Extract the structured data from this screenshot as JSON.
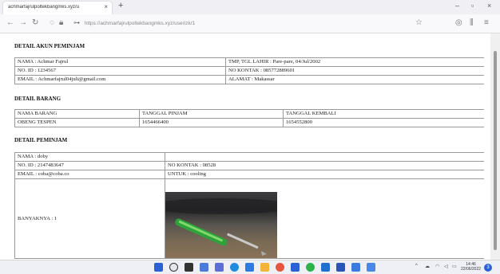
{
  "browser": {
    "tab_title": "achmarfajrulpoltekbangmks.xyz/u",
    "tab_close": "×",
    "new_tab": "+",
    "url_domain": "https://achmarfajrulpoltekbangmks.xyz",
    "url_path": "/userizk/1",
    "win_min": "–",
    "win_max": "▫",
    "win_close": "×"
  },
  "detail_akun": {
    "heading": "DETAIL AKUN PEMINJAM",
    "rows": [
      [
        "NAMA : Achmar Fajrul",
        "TMP, TGL LAHIR : Pare-pare, 04/Jul/2002"
      ],
      [
        "NO. ID : 1234567",
        "NO KONTAK : 085772889601"
      ],
      [
        "EMAIL : Achmarfajrul04juli@gmail.com",
        "ALAMAT : Makassar"
      ]
    ]
  },
  "detail_barang": {
    "heading": "DETAIL BARANG",
    "headers": [
      "NAMA BARANG",
      "TANGGAL PINJAM",
      "TANGGAL KEMBALI"
    ],
    "rows": [
      [
        "OBENG TESPEN",
        "1654466400",
        "1654552800"
      ]
    ]
  },
  "detail_peminjam": {
    "heading": "DETAIL PEMINJAM",
    "nama": "NAMA : doby",
    "no_id": "NO. ID : 2147483647",
    "no_kontak": "NO KONTAK : 08528",
    "email": "EMAIL : coba@coba.co",
    "untuk": "UNTUK : cooling",
    "banyaknya": "BANYAKNYA : 1"
  },
  "taskbar": {
    "time": "14:46",
    "date": "22/06/2022",
    "notif": "3"
  },
  "colors": {
    "taskbar_bg": "#eef0f5",
    "accent_blue": "#2a62d6"
  }
}
